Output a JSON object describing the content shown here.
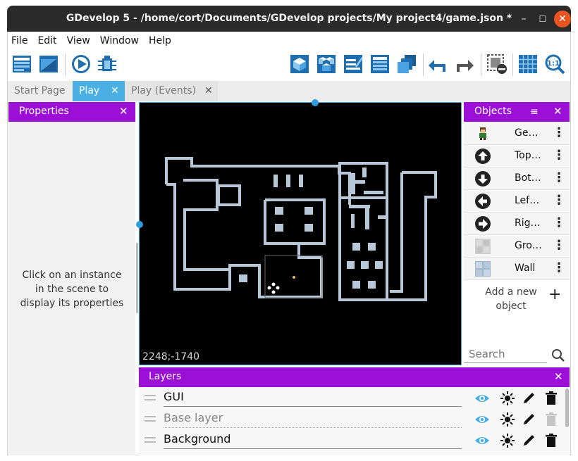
{
  "window": {
    "title": "GDevelop 5 - /home/cort/Documents/GDevelop projects/My project4/game.json *",
    "minimize": "–",
    "maximize": "☐",
    "close": "✕"
  },
  "menu": [
    "File",
    "Edit",
    "View",
    "Window",
    "Help"
  ],
  "toolbar": {
    "left": [
      "project-manager-icon",
      "scene-editor-icon",
      "preview-play-icon",
      "debugger-bug-icon"
    ],
    "right": [
      "object-editor-icon",
      "object-groups-icon",
      "properties-edit-icon",
      "instances-list-icon",
      "layers-icon",
      "undo-icon",
      "redo-icon",
      "clear-selection-icon",
      "grid-icon",
      "zoom-1to1-icon"
    ]
  },
  "tabs": [
    {
      "label": "Start Page",
      "active": false
    },
    {
      "label": "Play",
      "active": true,
      "close": "✕"
    },
    {
      "label": "Play (Events)",
      "active": false,
      "close": "✕"
    }
  ],
  "properties": {
    "title": "Properties",
    "close": "✕",
    "message": "Click on an instance in the scene to display its properties"
  },
  "scene": {
    "coordinates": "2248;-1740",
    "background": "#000000"
  },
  "objects": {
    "title": "Objects",
    "filter": "≡",
    "close": "✕",
    "items": [
      {
        "name": "Ge…",
        "icon": "character-sprite-icon"
      },
      {
        "name": "Top…",
        "icon": "arrow-up-icon"
      },
      {
        "name": "Bot…",
        "icon": "arrow-down-icon"
      },
      {
        "name": "Lef…",
        "icon": "arrow-left-icon"
      },
      {
        "name": "Rig…",
        "icon": "arrow-right-icon"
      },
      {
        "name": "Gro…",
        "icon": "ground-tile-icon"
      },
      {
        "name": "Wall",
        "icon": "wall-tile-icon"
      }
    ],
    "add_label": "Add a new object",
    "add_plus": "+",
    "search_placeholder": "Search"
  },
  "layers": {
    "title": "Layers",
    "close": "✕",
    "items": [
      {
        "name": "GUI",
        "dim": false
      },
      {
        "name": "Base layer",
        "dim": true
      },
      {
        "name": "Background",
        "dim": false
      }
    ]
  },
  "colors": {
    "panel_header": "#9b0fd6",
    "tab_active": "#4ab0e4",
    "wall": "#b9c8d8",
    "close_button": "#e95420"
  }
}
